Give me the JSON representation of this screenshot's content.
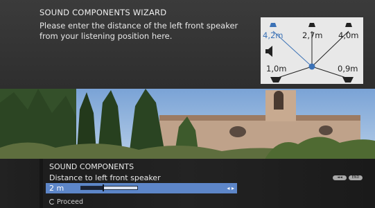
{
  "wizard": {
    "title": "SOUND COMPONENTS WIZARD",
    "message": "Please enter the distance of the left front speaker from your listening position here."
  },
  "diagram": {
    "labels": {
      "front_left": "4,2m",
      "center": "2,7m",
      "front_right": "4,0m",
      "rear_left": "1,0m",
      "rear_right": "0,9m"
    },
    "accent_color": "#3c72b6"
  },
  "panel": {
    "title": "SOUND COMPONENTS",
    "subtitle": "Distance to left front speaker",
    "value": "2 m",
    "slider_fraction": 0.4,
    "proceed_label": "Proceed",
    "back_button_glyph": "◄◄",
    "end_button_label": "END"
  }
}
